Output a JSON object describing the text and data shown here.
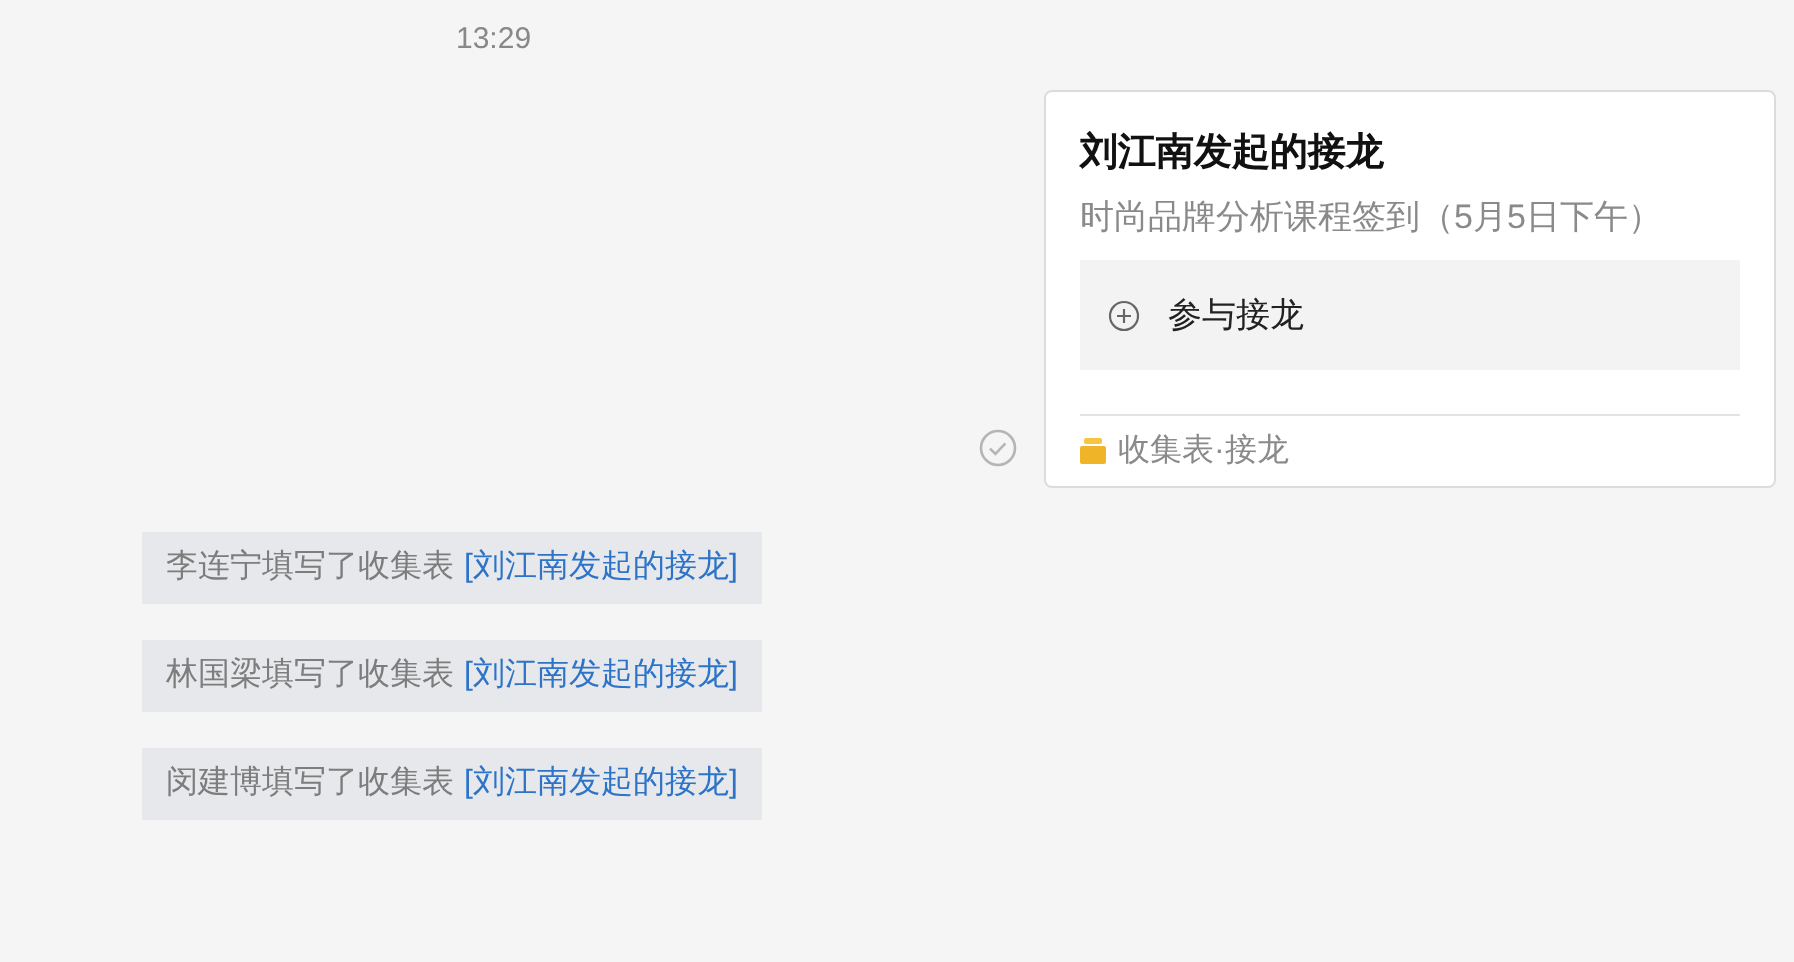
{
  "timestamp": "13:29",
  "card": {
    "title": "刘江南发起的接龙",
    "subtitle": "时尚品牌分析课程签到（5月5日下午）",
    "action": "参与接龙",
    "footer": "收集表·接龙",
    "read": true
  },
  "notices": [
    {
      "text": "李连宁填写了收集表",
      "link": "[刘江南发起的接龙]"
    },
    {
      "text": "林国梁填写了收集表",
      "link": "[刘江南发起的接龙]"
    },
    {
      "text": "闵建博填写了收集表",
      "link": "[刘江南发起的接龙]"
    }
  ]
}
